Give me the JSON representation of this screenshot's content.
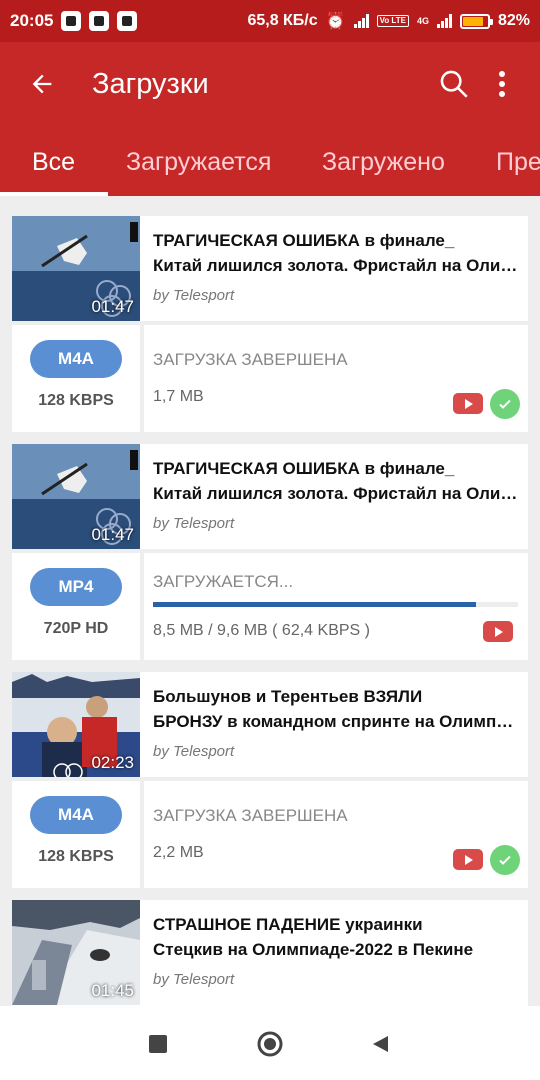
{
  "status_bar": {
    "time": "20:05",
    "network_speed": "65,8 КБ/с",
    "network_label": "4G",
    "volte_label": "Vo LTE",
    "battery": "82%",
    "battery_level": 0.82,
    "battery_color": "#ffb300"
  },
  "app_bar": {
    "title": "Загрузки",
    "back_icon": "arrow-left",
    "search_icon": "search",
    "more_icon": "more-vertical"
  },
  "tabs": [
    {
      "label": "Все",
      "active": true
    },
    {
      "label": "Загружается",
      "active": false
    },
    {
      "label": "Загружено",
      "active": false
    },
    {
      "label": "Пре",
      "active": false
    }
  ],
  "downloads": [
    {
      "title_line1": "ТРАГИЧЕСКАЯ ОШИБКА в финале_",
      "title_line2": "Китай лишился золота. Фристайл на Олимпиаде",
      "author": "by Telesport",
      "duration": "01:47",
      "format": "M4A",
      "quality": "128 KBPS",
      "status": "ЗАГРУЗКА ЗАВЕРШЕНА",
      "size": "1,7 MB",
      "completed": true
    },
    {
      "title_line1": "ТРАГИЧЕСКАЯ ОШИБКА в финале_",
      "title_line2": "Китай лишился золота. Фристайл на Олимпиаде",
      "author": "by Telesport",
      "duration": "01:47",
      "format": "MP4",
      "quality": "720P HD",
      "status": "ЗАГРУЖАЕТСЯ...",
      "size": "8,5 MB / 9,6 MB ( 62,4 KBPS )",
      "progress": 0.885,
      "completed": false
    },
    {
      "title_line1": "Большунов и Терентьев ВЗЯЛИ",
      "title_line2": "БРОНЗУ в командном спринте на Олимпиаде",
      "author": "by Telesport",
      "duration": "02:23",
      "format": "M4A",
      "quality": "128 KBPS",
      "status": "ЗАГРУЗКА ЗАВЕРШЕНА",
      "size": "2,2 MB",
      "completed": true
    },
    {
      "title_line1": "СТРАШНОЕ ПАДЕНИЕ украинки",
      "title_line2": "Стецкив на Олимпиаде-2022 в Пекине",
      "author": "by Telesport",
      "duration": "01:45"
    }
  ],
  "colors": {
    "status_bar": "#b71c1c",
    "app_bar": "#c62828",
    "format_pill": "#5b8fd4",
    "progress": "#2962a8",
    "youtube": "#d84b48",
    "check": "#6fd37a"
  },
  "nav_bar": {
    "recents_icon": "square",
    "home_icon": "circle",
    "back_icon": "triangle"
  }
}
